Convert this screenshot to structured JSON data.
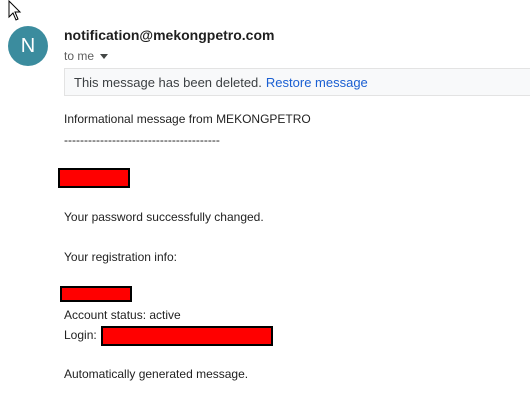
{
  "email": {
    "sender": "notification@mekongpetro.com",
    "avatar_letter": "N",
    "avatar_color": "#3b8c9e",
    "to_label": "to me",
    "deleted_notice": "This message has been deleted.",
    "restore_label": "Restore message",
    "body": {
      "intro": "Informational message from MEKONGPETRO",
      "separator": "---------------------------------------",
      "password_changed": "Your password successfully changed.",
      "registration_info": "Your registration info:",
      "account_status": "Account status: active",
      "login_label": "Login:",
      "auto_generated": "Automatically generated message."
    }
  },
  "redaction_color": "#ff0000"
}
